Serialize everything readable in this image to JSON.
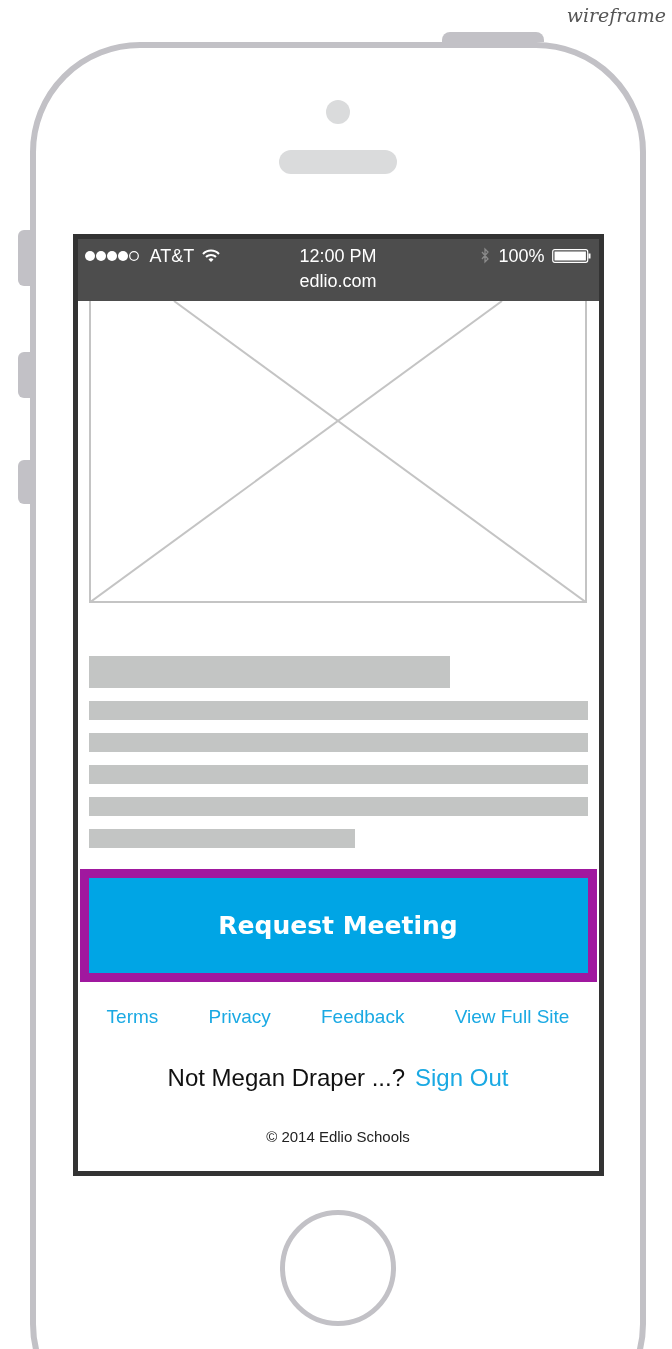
{
  "label": "wireframe",
  "status_bar": {
    "carrier": "AT&T",
    "time": "12:00 PM",
    "battery": "100%",
    "url": "edlio.com"
  },
  "button": {
    "label": "Request Meeting"
  },
  "footer_links": [
    "Terms",
    "Privacy",
    "Feedback",
    "View Full Site"
  ],
  "account": {
    "text": "Not Megan Draper ...?",
    "link": "Sign Out"
  },
  "copyright": "© 2014 Edlio Schools"
}
